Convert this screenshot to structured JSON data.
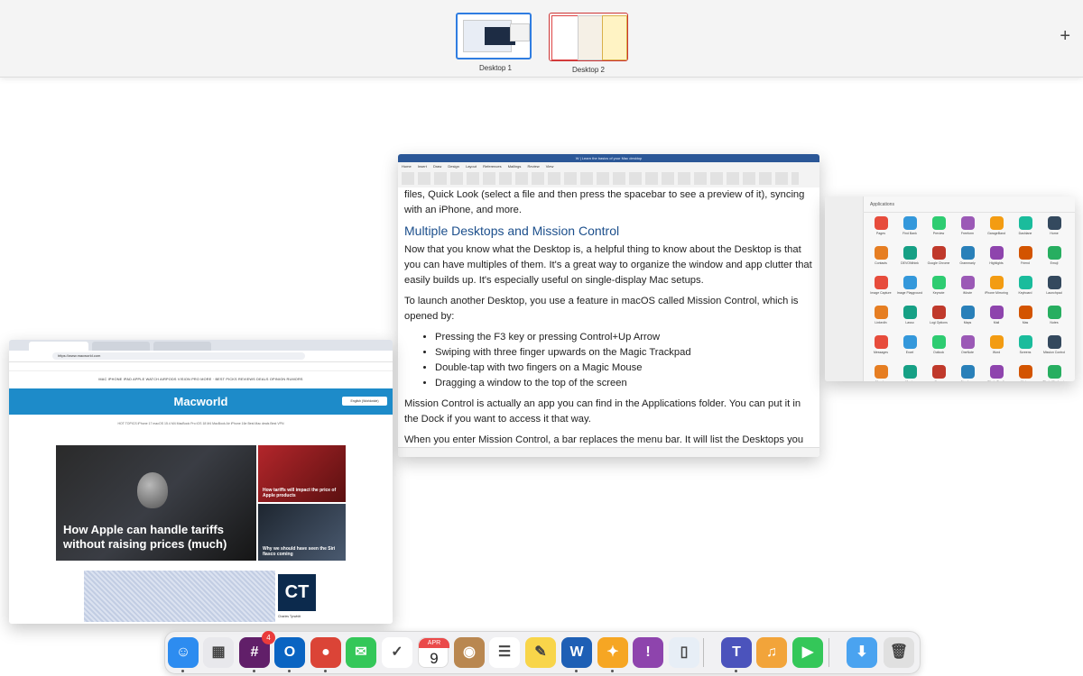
{
  "spaces": [
    {
      "label": "Desktop 1",
      "active": true
    },
    {
      "label": "Desktop 2",
      "active": false
    }
  ],
  "add_space_label": "+",
  "word_window": {
    "title_bar": "W | Learn the basics of your Mac desktop",
    "ribbon_tabs": [
      "Home",
      "Insert",
      "Draw",
      "Design",
      "Layout",
      "References",
      "Mailings",
      "Review",
      "View"
    ],
    "intro_line_1": "files, Quick Look (select a file and then press the spacebar to see a preview of it), syncing",
    "intro_line_2": "with an iPhone, and more.",
    "heading": "Multiple Desktops and Mission Control",
    "para1": "Now that you know what the Desktop is, a helpful thing to know about the Desktop is that you can have multiples of them. It's a great way to organize the window and app clutter that easily builds up. It's especially useful on single-display Mac setups.",
    "para2": "To launch another Desktop, you use a feature in macOS called Mission Control, which is opened by:",
    "bullets": [
      "Pressing the F3 key or pressing Control+Up Arrow",
      "Swiping with three finger upwards on the Magic Trackpad",
      "Double-tap with two fingers on a Magic Mouse",
      "Dragging a window to the top of the screen"
    ],
    "para3": "Mission Control is actually an app you can find in the Applications folder. You can put it in the Dock if you want to access it that way.",
    "para4": "When you enter Mission Control, a bar replaces the menu bar. It will list the Desktops you"
  },
  "finder_window": {
    "title": "Applications",
    "apps": [
      "Pages",
      "Find Bank",
      "Preview",
      "Freeform",
      "GarageBand",
      "Dashlane",
      "Home",
      "Contacts",
      "DEVONthink",
      "Google Chrome",
      "Grammarly",
      "Highlights",
      "Friend",
      "Emoji",
      "Image Capture",
      "Image Playground",
      "Keynote",
      "iMovie",
      "iPhone Mirroring",
      "Keyboard",
      "Launchpad",
      "LinkedIn",
      "Lasso",
      "Logi Options",
      "Maps",
      "Mail",
      "Mas",
      "Notes",
      "Messages",
      "Excel",
      "Outlook",
      "OneNote",
      "Word",
      "Screens",
      "Mission Control",
      "Monday",
      "Music",
      "News",
      "Numbers",
      "Photo Booth",
      "Notes",
      "Photo Mechanic"
    ]
  },
  "browser_window": {
    "url": "https://www.macworld.com",
    "nav_links": "MAC   IPHONE   IPAD   APPLE WATCH   AIRPODS   VISION PRO   MORE  ·  BEST PICKS   REVIEWS   DEALS   OPINION   RUMORS",
    "logo": "Macworld",
    "region_button": "English (Worldwide)",
    "sub_nav": "HOT TOPICS   iPhone 17   macOS 15.4   M4 MacBook Pro   iOS 18   M4 MacBook Air   iPhone 16e   Best Mac deals   Best VPN",
    "hero_title": "How Apple can handle tariffs without raising prices (much)",
    "card1_title": "How tariffs will impact the price of Apple products",
    "card2_title": "Why we should have seen the Siri fiasco coming",
    "ad_logo": "CT",
    "ad_label": "Charles Tyrwhitt"
  },
  "dock": {
    "apps": [
      {
        "name": "finder",
        "glyph": "☺",
        "color": "#2d8cf0",
        "open": true
      },
      {
        "name": "launchpad",
        "glyph": "▦",
        "color": "#e8e8ec",
        "open": false
      },
      {
        "name": "slack",
        "glyph": "#",
        "color": "#611f69",
        "open": true,
        "badge": "4"
      },
      {
        "name": "outlook",
        "glyph": "O",
        "color": "#0a64c2",
        "open": true
      },
      {
        "name": "chrome",
        "glyph": "●",
        "color": "#db4437",
        "open": true
      },
      {
        "name": "messages",
        "glyph": "✉",
        "color": "#34c759",
        "open": false
      },
      {
        "name": "monday",
        "glyph": "✓",
        "color": "#ffffff",
        "open": false
      },
      {
        "name": "calendar",
        "month": "APR",
        "day": "9",
        "open": false
      },
      {
        "name": "contacts",
        "glyph": "◉",
        "color": "#b98750",
        "open": false
      },
      {
        "name": "reminders",
        "glyph": "☰",
        "color": "#ffffff",
        "open": false
      },
      {
        "name": "notes",
        "glyph": "✎",
        "color": "#f8d54a",
        "open": false
      },
      {
        "name": "word",
        "glyph": "W",
        "color": "#1e5fb5",
        "open": true
      },
      {
        "name": "pixelmator",
        "glyph": "✦",
        "color": "#f6a623",
        "open": true
      },
      {
        "name": "feedback",
        "glyph": "!",
        "color": "#8e44ad",
        "open": false
      },
      {
        "name": "iphone-mirroring",
        "glyph": "▯",
        "color": "#e7eef6",
        "open": false
      },
      {
        "name": "teams",
        "glyph": "T",
        "color": "#4b53bc",
        "open": true
      },
      {
        "name": "audacity",
        "glyph": "♫",
        "color": "#f2a43a",
        "open": false
      },
      {
        "name": "facetime",
        "glyph": "▶",
        "color": "#34c759",
        "open": false
      },
      {
        "name": "downloads",
        "glyph": "⬇",
        "color": "#4aa3f0",
        "open": false
      },
      {
        "name": "trash",
        "glyph": "🗑",
        "color": "#e0e0e0",
        "open": false
      }
    ]
  }
}
